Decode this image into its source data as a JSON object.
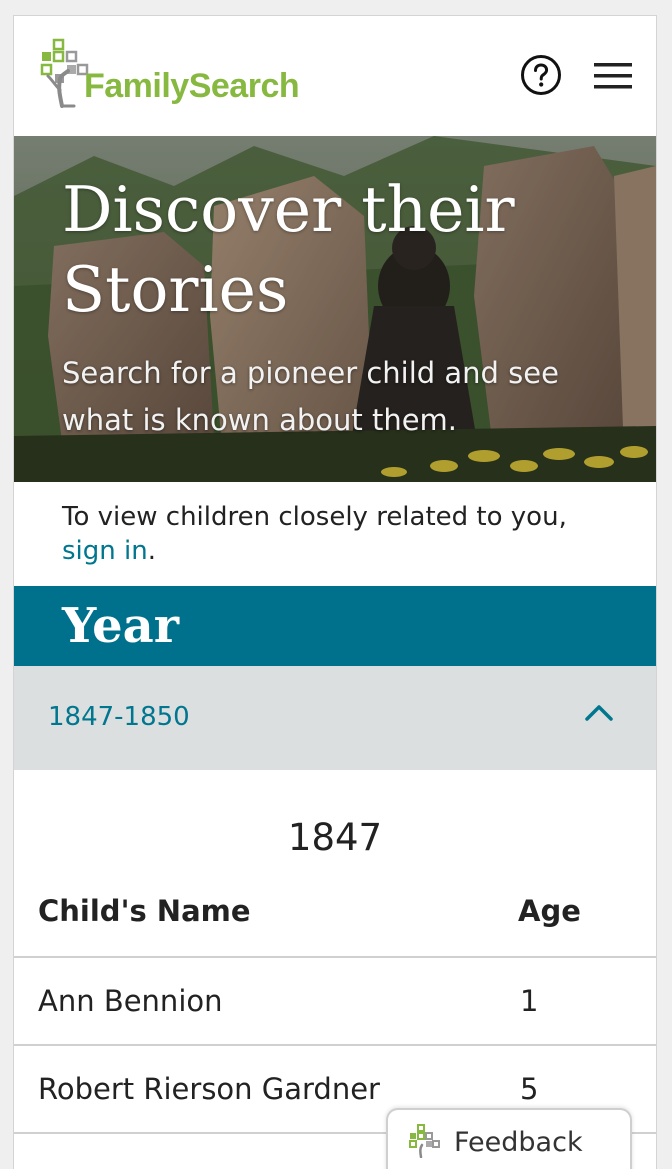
{
  "header": {
    "logo_text": "FamilySearch",
    "help_icon": "help-circle-icon",
    "menu_icon": "hamburger-menu-icon",
    "brand_color": "#87b840"
  },
  "hero": {
    "title": "Discover their Stories",
    "subtitle": "Search for a pioneer child and see what is known about them."
  },
  "signin": {
    "prefix": "To view children closely related to you, ",
    "link_text": "sign in",
    "suffix": "."
  },
  "year_section": {
    "title": "Year",
    "band_color": "#00718d",
    "accordion": {
      "label": "1847-1850",
      "icon": "chevron-up-icon",
      "expanded": true
    }
  },
  "table": {
    "year_heading": "1847",
    "columns": [
      "Child's Name",
      "Age"
    ],
    "rows": [
      {
        "name": "Ann Bennion",
        "age": "1"
      },
      {
        "name": "Robert Rierson Gardner",
        "age": "5"
      }
    ]
  },
  "feedback": {
    "label": "Feedback",
    "icon": "tree-logo-icon"
  }
}
